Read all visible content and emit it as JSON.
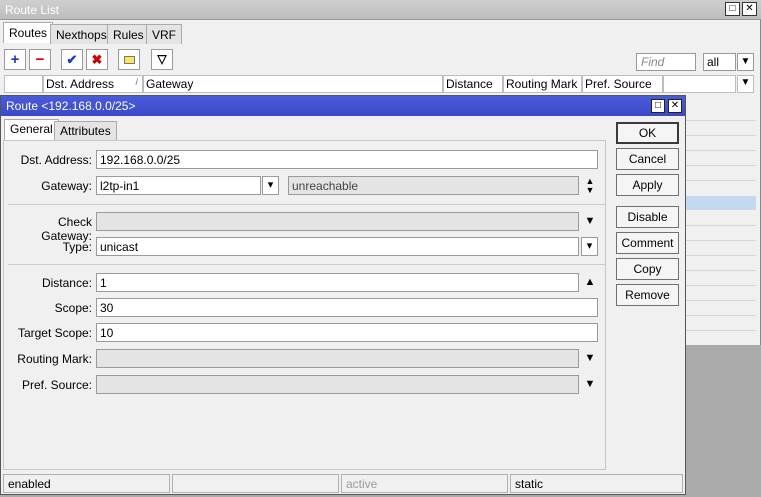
{
  "route_list": {
    "title": "Route List",
    "tabs": [
      "Routes",
      "Nexthops",
      "Rules",
      "VRF"
    ],
    "find_placeholder": "Find",
    "filter_value": "all",
    "columns": [
      "Dst. Address",
      "Gateway",
      "Distance",
      "Routing Mark",
      "Pref. Source"
    ]
  },
  "dialog": {
    "title": "Route <192.168.0.0/25>",
    "tabs": [
      "General",
      "Attributes"
    ],
    "fields": {
      "dst_address": {
        "label": "Dst. Address:",
        "value": "192.168.0.0/25"
      },
      "gateway": {
        "label": "Gateway:",
        "value": "l2tp-in1",
        "status": "unreachable"
      },
      "check_gateway": {
        "label": "Check Gateway:",
        "value": ""
      },
      "type": {
        "label": "Type:",
        "value": "unicast"
      },
      "distance": {
        "label": "Distance:",
        "value": "1"
      },
      "scope": {
        "label": "Scope:",
        "value": "30"
      },
      "target_scope": {
        "label": "Target Scope:",
        "value": "10"
      },
      "routing_mark": {
        "label": "Routing Mark:",
        "value": ""
      },
      "pref_source": {
        "label": "Pref. Source:",
        "value": ""
      }
    },
    "buttons": {
      "ok": "OK",
      "cancel": "Cancel",
      "apply": "Apply",
      "disable": "Disable",
      "comment": "Comment",
      "copy": "Copy",
      "remove": "Remove"
    },
    "status": {
      "state": "enabled",
      "active": "active",
      "kind": "static"
    }
  }
}
